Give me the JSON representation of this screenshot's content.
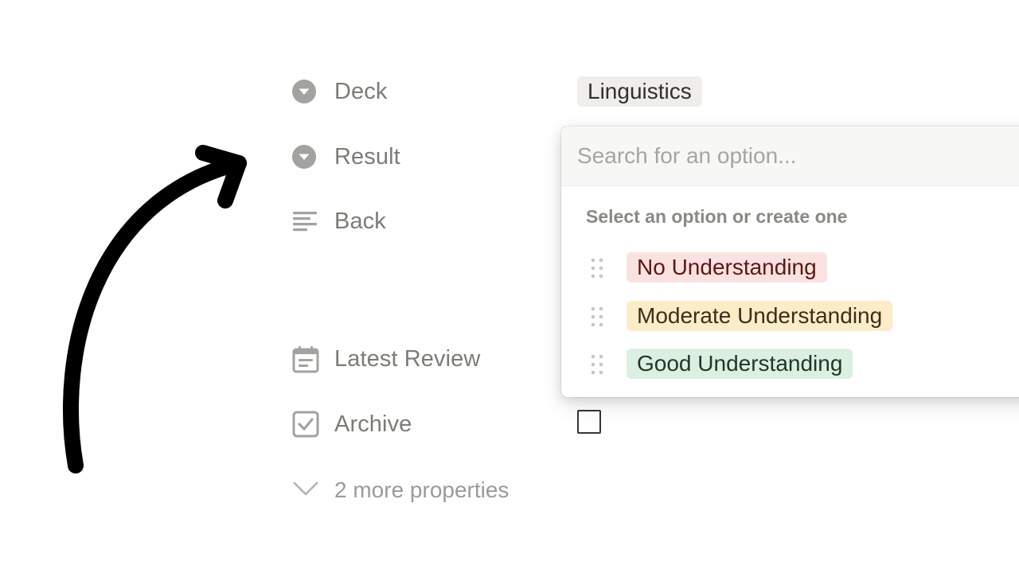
{
  "properties": [
    {
      "label": "Deck",
      "icon": "select-icon"
    },
    {
      "label": "Result",
      "icon": "select-icon"
    },
    {
      "label": "Back",
      "icon": "text-lines-icon"
    },
    {
      "label": "Latest Review",
      "icon": "calendar-icon"
    },
    {
      "label": "Archive",
      "icon": "checkbox-icon"
    }
  ],
  "deck_value": "Linguistics",
  "archive_checked": false,
  "more_properties": "2 more properties",
  "dropdown": {
    "search_placeholder": "Search for an option...",
    "header": "Select an option or create one",
    "options": [
      {
        "label": "No Understanding",
        "bg": "#fbe2e1",
        "fg": "#5d1715"
      },
      {
        "label": "Moderate Understanding",
        "bg": "#fcecc8",
        "fg": "#402c1b"
      },
      {
        "label": "Good Understanding",
        "bg": "#dcefe1",
        "fg": "#1c3829"
      }
    ]
  },
  "colors": {
    "icon_gray": "#a3a29e",
    "label_gray": "#7d7b76",
    "arrow": "#000000"
  }
}
